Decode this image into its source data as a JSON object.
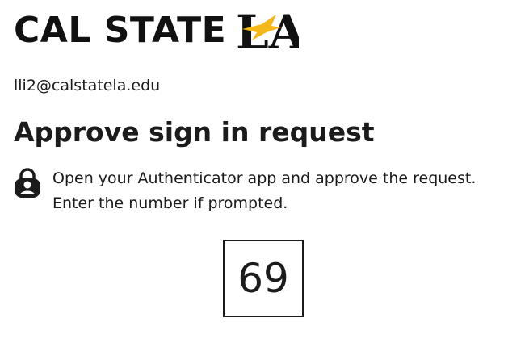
{
  "logo": {
    "brand_text": "CAL STATE",
    "mark_text": "LA",
    "accent_color": "#f5b81c"
  },
  "account": {
    "email": "lli2@calstatela.edu"
  },
  "title": "Approve sign in request",
  "instruction": {
    "icon": "lock-person-icon",
    "line1": "Open your Authenticator app and approve the request.",
    "line2": "Enter the number if prompted."
  },
  "number_match": {
    "value": "69"
  }
}
